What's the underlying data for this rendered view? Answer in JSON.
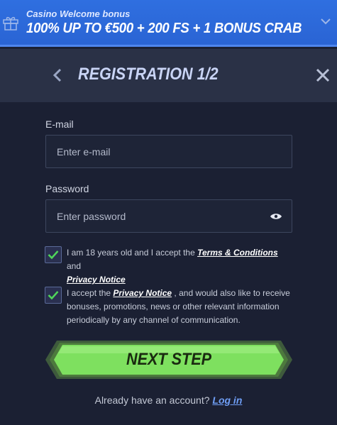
{
  "banner": {
    "subtitle": "Casino Welcome bonus",
    "title": "100% UP TO €500 + 200 FS + 1 BONUS CRAB"
  },
  "header": {
    "title": "REGISTRATION 1/2"
  },
  "form": {
    "email_label": "E-mail",
    "email_placeholder": "Enter e-mail",
    "email_value": "",
    "password_label": "Password",
    "password_placeholder": "Enter password",
    "password_value": ""
  },
  "consent1": {
    "checked": true,
    "text_before": "I am 18 years old and I accept the ",
    "terms_link": "Terms & Conditions",
    "text_and": " and ",
    "privacy_link": "Privacy Notice"
  },
  "consent2": {
    "checked": true,
    "text_before": "I accept the ",
    "privacy_link": "Privacy Notice",
    "text_after": " , and would also like to receive bonuses, promotions, news or other relevant information periodically by any channel of communication."
  },
  "next_button": {
    "label": "NEXT STEP"
  },
  "login": {
    "prompt": "Already have an account? ",
    "link": "Log in"
  },
  "colors": {
    "background": "#1b2033",
    "banner": "#2a64d4",
    "header": "#2a3146",
    "button_green": "#7ee05f",
    "checkmark_green": "#4fd65a"
  }
}
